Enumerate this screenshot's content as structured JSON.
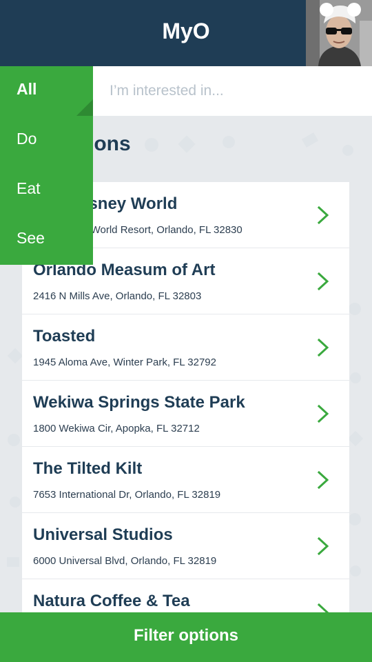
{
  "header": {
    "title": "MyO",
    "avatar_icon": "user-avatar-photo"
  },
  "search": {
    "placeholder": "I’m interested in..."
  },
  "section": {
    "title": "Locations"
  },
  "filter_menu": {
    "items": [
      {
        "label": "All",
        "active": true
      },
      {
        "label": "Do"
      },
      {
        "label": "Eat"
      },
      {
        "label": "See"
      }
    ]
  },
  "locations": [
    {
      "name": "Walt Disney World",
      "address": "Walt Disney World Resort, Orlando, FL 32830"
    },
    {
      "name": "Orlando Measum of Art",
      "address": "2416 N Mills Ave, Orlando, FL 32803"
    },
    {
      "name": "Toasted",
      "address": "1945 Aloma Ave, Winter Park, FL 32792"
    },
    {
      "name": "Wekiwa Springs State Park",
      "address": "1800 Wekiwa Cir, Apopka, FL 32712"
    },
    {
      "name": "The Tilted Kilt",
      "address": "7653 International Dr, Orlando, FL 32819"
    },
    {
      "name": "Universal Studios",
      "address": "6000 Universal Blvd, Orlando, FL 32819"
    },
    {
      "name": "Natura Coffee & Tea",
      "address": ""
    }
  ],
  "footer": {
    "filter_label": "Filter options"
  },
  "colors": {
    "header_bg": "#1f3d55",
    "accent_green": "#3aa93e",
    "text_dark": "#1f3d55",
    "background": "#e6e9ec"
  }
}
